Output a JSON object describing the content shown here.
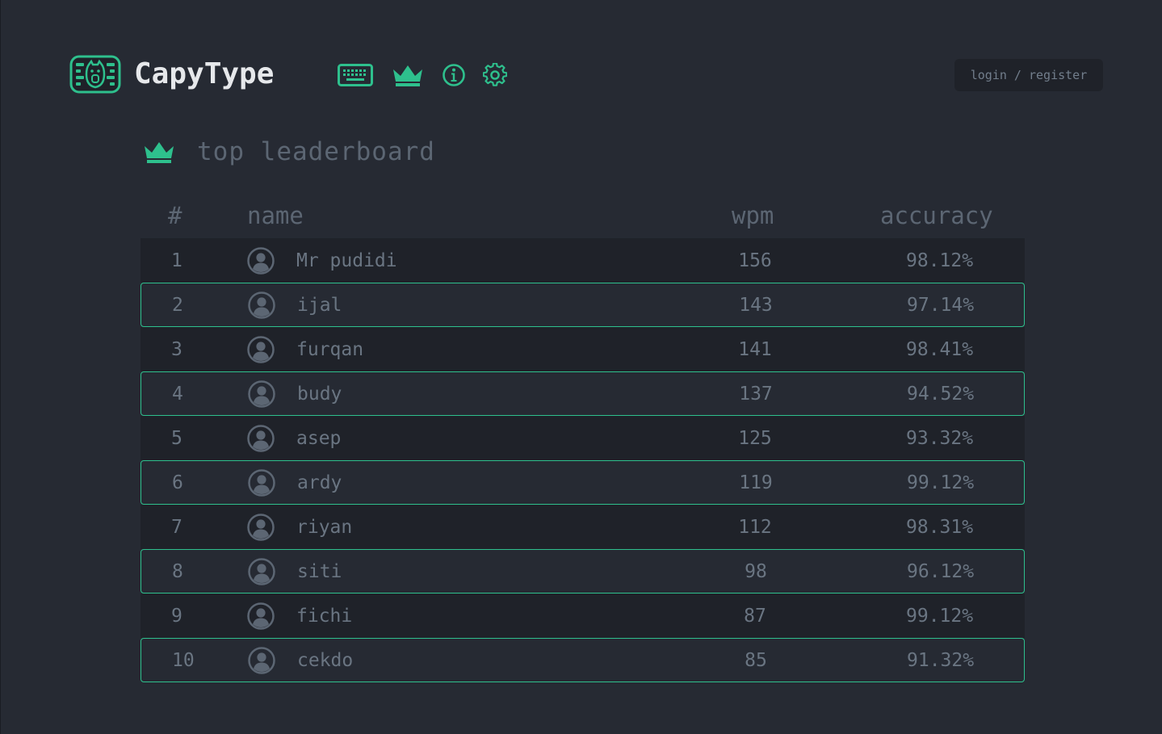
{
  "app": {
    "brand": "CapyType",
    "login_label": "login / register",
    "accent_color": "#2ec08d"
  },
  "nav": {
    "items": [
      {
        "icon": "keyboard-icon"
      },
      {
        "icon": "crown-icon"
      },
      {
        "icon": "info-icon"
      },
      {
        "icon": "gear-icon"
      }
    ]
  },
  "leaderboard": {
    "title": "top leaderboard",
    "headers": {
      "rank": "#",
      "name": "name",
      "wpm": "wpm",
      "accuracy": "accuracy"
    },
    "rows": [
      {
        "rank": "1",
        "name": "Mr pudidi",
        "wpm": "156",
        "accuracy": "98.12%"
      },
      {
        "rank": "2",
        "name": "ijal",
        "wpm": "143",
        "accuracy": "97.14%"
      },
      {
        "rank": "3",
        "name": "furqan",
        "wpm": "141",
        "accuracy": "98.41%"
      },
      {
        "rank": "4",
        "name": "budy",
        "wpm": "137",
        "accuracy": "94.52%"
      },
      {
        "rank": "5",
        "name": "asep",
        "wpm": "125",
        "accuracy": "93.32%"
      },
      {
        "rank": "6",
        "name": "ardy",
        "wpm": "119",
        "accuracy": "99.12%"
      },
      {
        "rank": "7",
        "name": "riyan",
        "wpm": "112",
        "accuracy": "98.31%"
      },
      {
        "rank": "8",
        "name": "siti",
        "wpm": "98",
        "accuracy": "96.12%"
      },
      {
        "rank": "9",
        "name": "fichi",
        "wpm": "87",
        "accuracy": "99.12%"
      },
      {
        "rank": "10",
        "name": "cekdo",
        "wpm": "85",
        "accuracy": "91.32%"
      }
    ]
  }
}
